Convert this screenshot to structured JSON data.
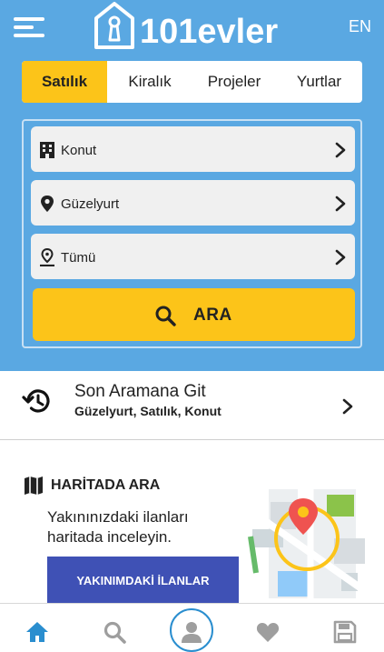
{
  "header": {
    "logo_text": "101evler",
    "language": "EN"
  },
  "tabs": [
    {
      "label": "Satılık",
      "active": true
    },
    {
      "label": "Kiralık",
      "active": false
    },
    {
      "label": "Projeler",
      "active": false
    },
    {
      "label": "Yurtlar",
      "active": false
    }
  ],
  "search": {
    "fields": [
      {
        "icon": "building-icon",
        "label": "Konut"
      },
      {
        "icon": "location-pin-icon",
        "label": "Güzelyurt"
      },
      {
        "icon": "area-pin-icon",
        "label": "Tümü"
      }
    ],
    "button_label": "ARA"
  },
  "last_search": {
    "title": "Son Aramana Git",
    "subtitle": "Güzelyurt, Satılık, Konut"
  },
  "map_section": {
    "title": "HARİTADA ARA",
    "description": "Yakınınızdaki ilanları haritada inceleyin.",
    "button_label": "YAKINIMDAKİ İLANLAR"
  },
  "bottom_nav": [
    {
      "name": "home-icon",
      "active": true
    },
    {
      "name": "search-icon",
      "active": false
    },
    {
      "name": "profile-icon",
      "active": false
    },
    {
      "name": "heart-icon",
      "active": false
    },
    {
      "name": "save-icon",
      "active": false
    }
  ],
  "colors": {
    "hero_bg": "#5aa8e2",
    "accent_yellow": "#fcc419",
    "button_blue": "#3f51b5",
    "active_nav": "#2a8ecf",
    "inactive_nav": "#9e9e9e"
  }
}
